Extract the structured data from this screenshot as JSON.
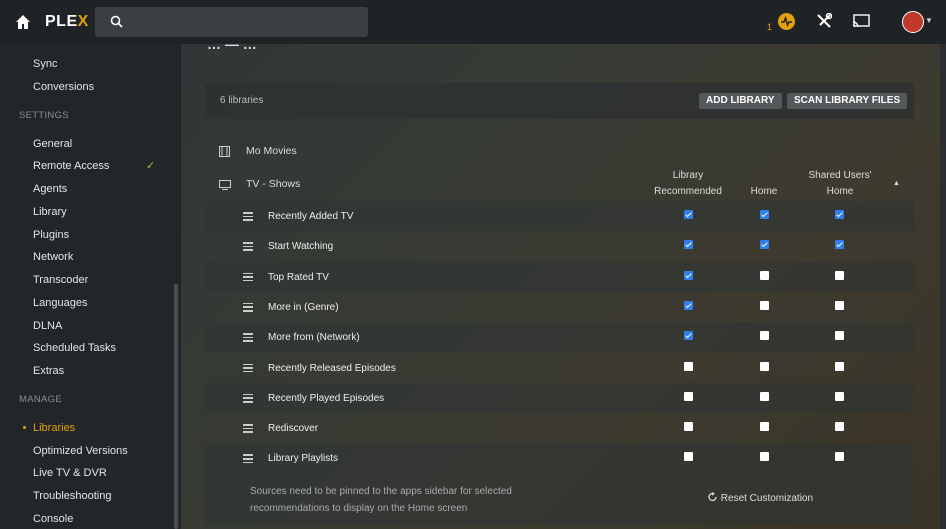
{
  "app": {
    "logo_main": "PLE",
    "logo_accent": "X"
  },
  "header": {
    "activity_count": "1"
  },
  "page": {
    "title_partial": "… — …"
  },
  "sidebar": {
    "items_top": [
      "Sync",
      "Conversions"
    ],
    "settings_header": "SETTINGS",
    "settings": [
      "General",
      "Remote Access",
      "Agents",
      "Library",
      "Plugins",
      "Network",
      "Transcoder",
      "Languages",
      "DLNA",
      "Scheduled Tasks",
      "Extras"
    ],
    "remote_access_status": "✓",
    "manage_header": "MANAGE",
    "manage": [
      "Libraries",
      "Optimized Versions",
      "Live TV & DVR",
      "Troubleshooting",
      "Console"
    ]
  },
  "libraries": {
    "count_label": "6 libraries",
    "add_button": "ADD LIBRARY",
    "scan_button": "SCAN LIBRARY FILES",
    "list": [
      "Mo Movies",
      "TV - Shows"
    ]
  },
  "columns": {
    "recommended_line1": "Library",
    "recommended_line2": "Recommended",
    "home": "Home",
    "shared_line1": "Shared Users'",
    "shared_line2": "Home"
  },
  "rows": [
    {
      "label": "Recently Added TV",
      "recommended": true,
      "home": true,
      "shared": true
    },
    {
      "label": "Start Watching",
      "recommended": true,
      "home": true,
      "shared": true
    },
    {
      "label": "Top Rated TV",
      "recommended": true,
      "home": false,
      "shared": false
    },
    {
      "label": "More in (Genre)",
      "recommended": true,
      "home": false,
      "shared": false
    },
    {
      "label": "More from (Network)",
      "recommended": true,
      "home": false,
      "shared": false
    },
    {
      "label": "Recently Released Episodes",
      "recommended": false,
      "home": false,
      "shared": false
    },
    {
      "label": "Recently Played Episodes",
      "recommended": false,
      "home": false,
      "shared": false
    },
    {
      "label": "Rediscover",
      "recommended": false,
      "home": false,
      "shared": false
    },
    {
      "label": "Library Playlists",
      "recommended": false,
      "home": false,
      "shared": false
    }
  ],
  "footer": {
    "note": "Sources need to be pinned to the apps sidebar for selected recommendations to display on the Home screen",
    "reset_label": "Reset Customization"
  },
  "colors": {
    "accent": "#e5a00d",
    "checkbox_on": "#2f80ed",
    "status_ok": "#8bc34a"
  }
}
